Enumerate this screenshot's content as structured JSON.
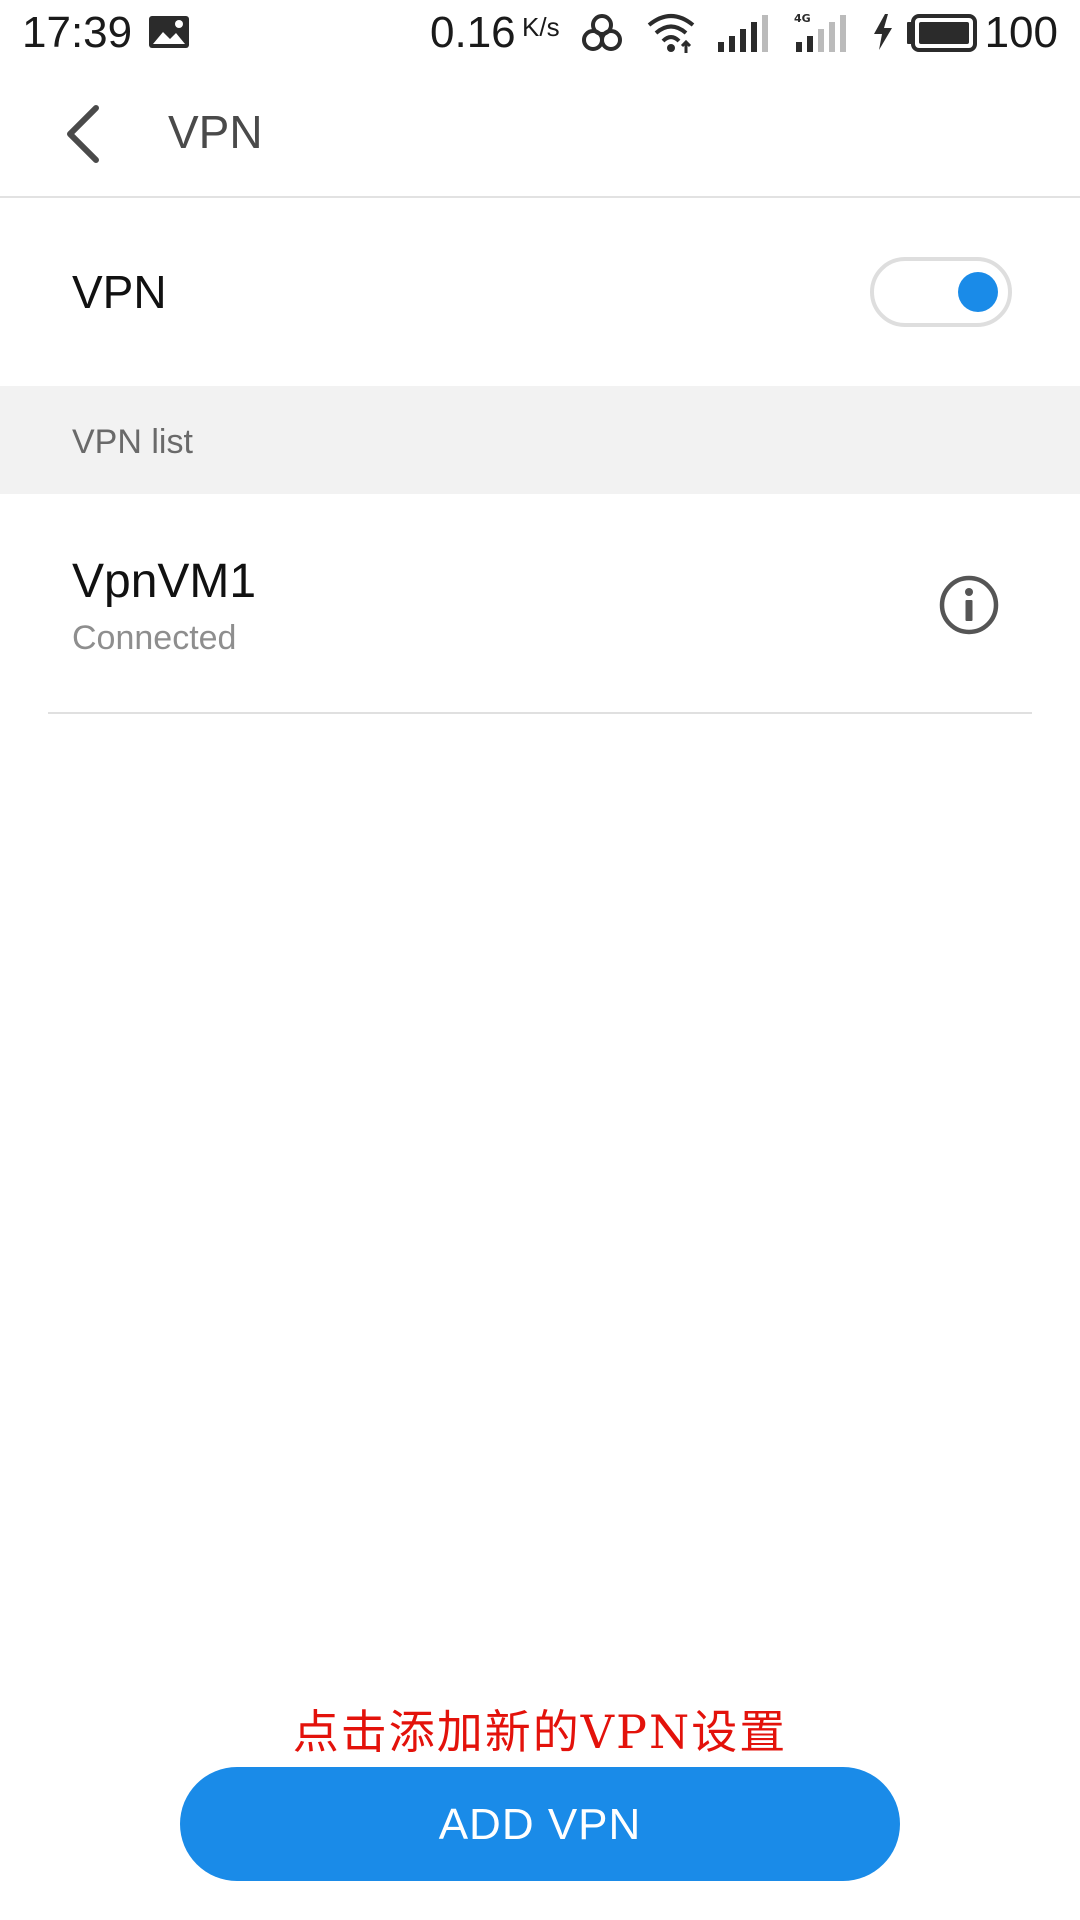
{
  "status_bar": {
    "time": "17:39",
    "net_speed": "0.16",
    "net_speed_unit": "K/s",
    "battery_percent": "100",
    "icons": [
      "photo-icon",
      "link-icon",
      "wifi-icon",
      "signal-icon",
      "signal-4g-icon",
      "charging-icon",
      "battery-icon"
    ]
  },
  "app_bar": {
    "title": "VPN",
    "back_icon": "chevron-left-icon"
  },
  "vpn_toggle": {
    "label": "VPN",
    "enabled": true
  },
  "vpn_list": {
    "header": "VPN list",
    "items": [
      {
        "name": "VpnVM1",
        "status": "Connected",
        "action_icon": "info-icon"
      }
    ]
  },
  "annotation": {
    "text": "点击添加新的VPN设置"
  },
  "add_button": {
    "label": "ADD VPN"
  },
  "colors": {
    "accent": "#1a8be8",
    "annotation": "#e3120b",
    "section_background": "#f2f2f2"
  }
}
